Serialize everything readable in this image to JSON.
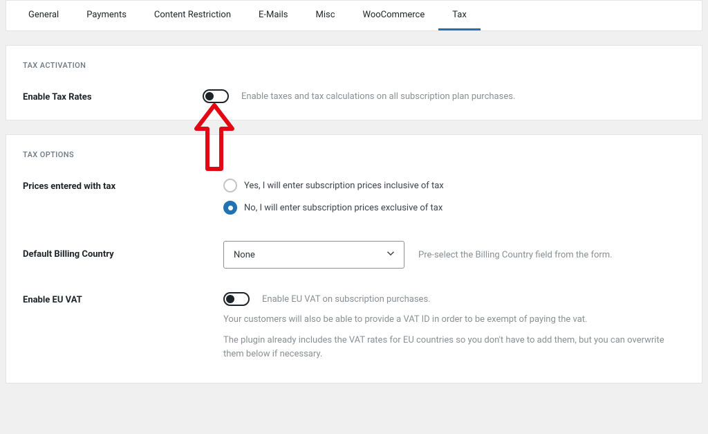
{
  "tabs": [
    "General",
    "Payments",
    "Content Restriction",
    "E-Mails",
    "Misc",
    "WooCommerce",
    "Tax"
  ],
  "active_tab_index": 6,
  "tax_activation": {
    "title": "TAX ACTIVATION",
    "enable_tax": {
      "label": "Enable Tax Rates",
      "help": "Enable taxes and tax calculations on all subscription plan purchases.",
      "enabled": false
    }
  },
  "tax_options": {
    "title": "TAX OPTIONS",
    "prices_with_tax": {
      "label": "Prices entered with tax",
      "options": [
        "Yes, I will enter subscription prices inclusive of tax",
        "No, I will enter subscription prices exclusive of tax"
      ],
      "selected_index": 1
    },
    "default_billing_country": {
      "label": "Default Billing Country",
      "value": "None",
      "help": "Pre-select the Billing Country field from the form."
    },
    "enable_eu_vat": {
      "label": "Enable EU VAT",
      "help": "Enable EU VAT on subscription purchases.",
      "note1": "Your customers will also be able to provide a VAT ID in order to be exempt of paying the vat.",
      "note2": "The plugin already includes the VAT rates for EU countries so you don't have to add them, but you can overwrite them below if necessary.",
      "enabled": false
    }
  }
}
